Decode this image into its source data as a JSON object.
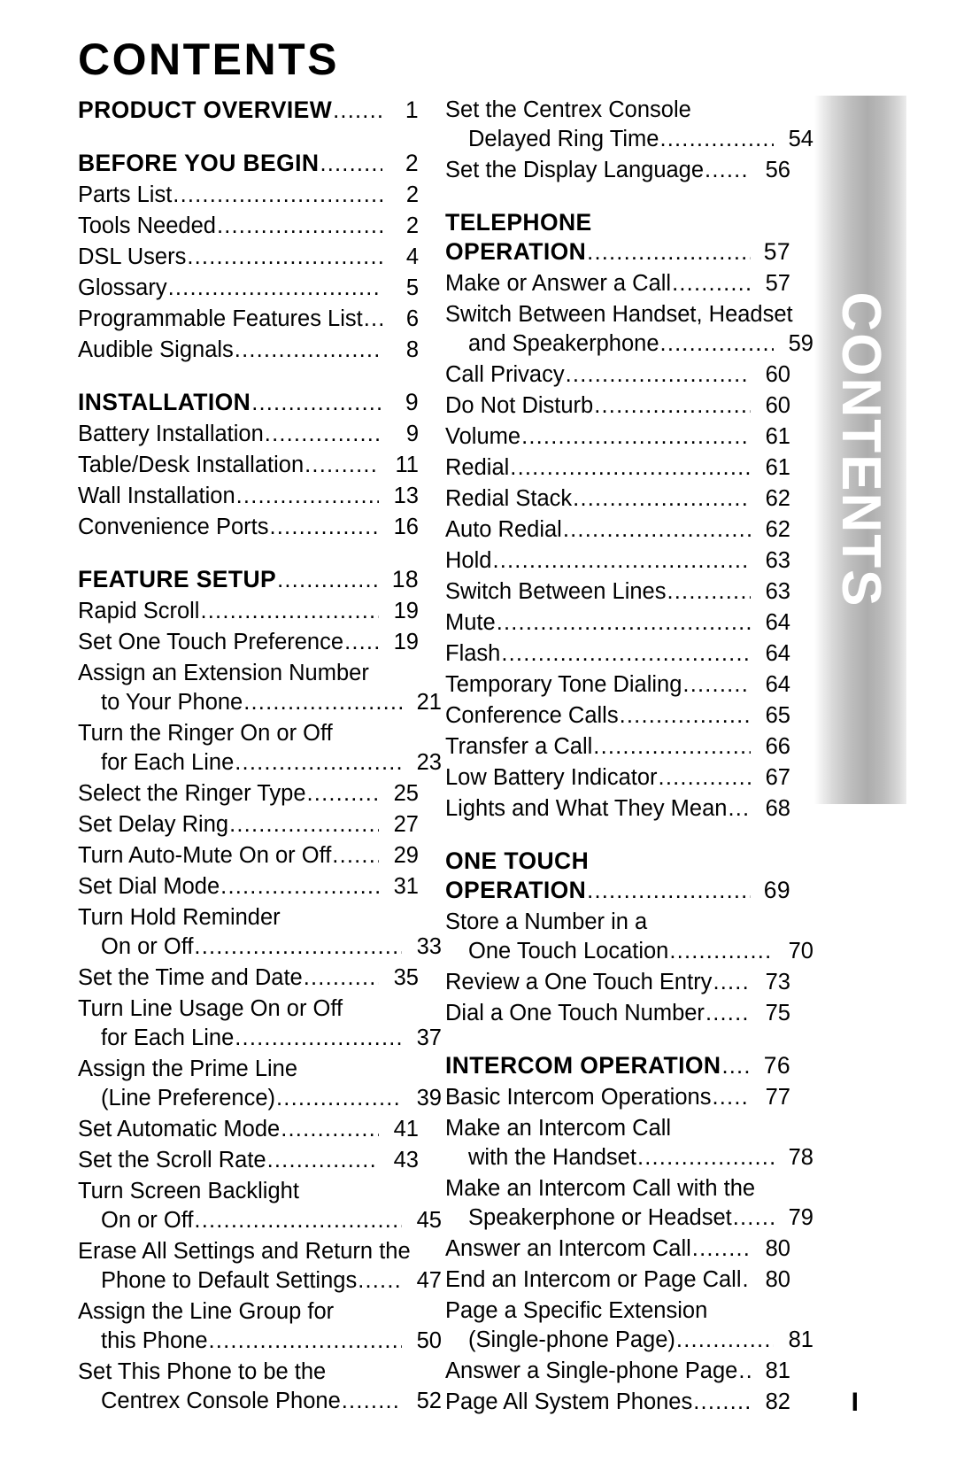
{
  "title": "CONTENTS",
  "side_tab": {
    "label": "CONTENTS"
  },
  "folio": "I",
  "columns": {
    "left": [
      {
        "kind": "head",
        "lines": [
          {
            "text": "PRODUCT OVERVIEW",
            "page": "1"
          }
        ]
      },
      {
        "kind": "head",
        "gap": true,
        "lines": [
          {
            "text": "BEFORE YOU BEGIN",
            "page": "2"
          }
        ]
      },
      {
        "kind": "sub",
        "lines": [
          {
            "text": "Parts List",
            "page": "2"
          }
        ]
      },
      {
        "kind": "sub",
        "lines": [
          {
            "text": "Tools Needed",
            "page": "2"
          }
        ]
      },
      {
        "kind": "sub",
        "lines": [
          {
            "text": "DSL Users",
            "page": "4"
          }
        ]
      },
      {
        "kind": "sub",
        "lines": [
          {
            "text": "Glossary",
            "page": "5"
          }
        ]
      },
      {
        "kind": "sub",
        "lines": [
          {
            "text": "Programmable Features List",
            "page": "6"
          }
        ]
      },
      {
        "kind": "sub",
        "lines": [
          {
            "text": "Audible Signals",
            "page": "8"
          }
        ]
      },
      {
        "kind": "head",
        "gap": true,
        "lines": [
          {
            "text": "INSTALLATION",
            "page": "9"
          }
        ]
      },
      {
        "kind": "sub",
        "lines": [
          {
            "text": "Battery Installation",
            "page": "9"
          }
        ]
      },
      {
        "kind": "sub",
        "lines": [
          {
            "text": "Table/Desk Installation",
            "page": "11"
          }
        ]
      },
      {
        "kind": "sub",
        "lines": [
          {
            "text": "Wall Installation",
            "page": "13"
          }
        ]
      },
      {
        "kind": "sub",
        "lines": [
          {
            "text": "Convenience Ports",
            "page": "16"
          }
        ]
      },
      {
        "kind": "head",
        "gap": true,
        "lines": [
          {
            "text": "FEATURE SETUP",
            "page": "18"
          }
        ]
      },
      {
        "kind": "sub",
        "lines": [
          {
            "text": "Rapid Scroll",
            "page": "19"
          }
        ]
      },
      {
        "kind": "sub",
        "lines": [
          {
            "text": "Set One Touch Preference",
            "page": "19"
          }
        ]
      },
      {
        "kind": "sub",
        "lines": [
          {
            "text": "Assign an Extension Number",
            "page": ""
          },
          {
            "text": "to Your Phone",
            "page": "21",
            "cont": true
          }
        ]
      },
      {
        "kind": "sub",
        "lines": [
          {
            "text": "Turn the Ringer On or Off",
            "page": ""
          },
          {
            "text": "for Each Line",
            "page": "23",
            "cont": true
          }
        ]
      },
      {
        "kind": "sub",
        "lines": [
          {
            "text": "Select the Ringer Type",
            "page": "25"
          }
        ]
      },
      {
        "kind": "sub",
        "lines": [
          {
            "text": "Set Delay Ring",
            "page": "27"
          }
        ]
      },
      {
        "kind": "sub",
        "lines": [
          {
            "text": "Turn Auto-Mute On or Off",
            "page": "29"
          }
        ]
      },
      {
        "kind": "sub",
        "lines": [
          {
            "text": "Set Dial Mode",
            "page": "31"
          }
        ]
      },
      {
        "kind": "sub",
        "lines": [
          {
            "text": "Turn Hold Reminder",
            "page": ""
          },
          {
            "text": "On or Off",
            "page": "33",
            "cont": true
          }
        ]
      },
      {
        "kind": "sub",
        "lines": [
          {
            "text": "Set the Time and Date",
            "page": "35"
          }
        ]
      },
      {
        "kind": "sub",
        "lines": [
          {
            "text": "Turn Line Usage On or Off",
            "page": ""
          },
          {
            "text": "for Each Line",
            "page": "37",
            "cont": true
          }
        ]
      },
      {
        "kind": "sub",
        "lines": [
          {
            "text": "Assign the Prime Line",
            "page": ""
          },
          {
            "text": "(Line Preference)",
            "page": "39",
            "cont": true
          }
        ]
      },
      {
        "kind": "sub",
        "lines": [
          {
            "text": "Set Automatic Mode",
            "page": "41"
          }
        ]
      },
      {
        "kind": "sub",
        "lines": [
          {
            "text": "Set the Scroll Rate",
            "page": "43"
          }
        ]
      },
      {
        "kind": "sub",
        "lines": [
          {
            "text": "Turn Screen Backlight",
            "page": ""
          },
          {
            "text": "On or Off",
            "page": "45",
            "cont": true
          }
        ]
      },
      {
        "kind": "sub",
        "lines": [
          {
            "text": "Erase All Settings and Return the",
            "page": ""
          },
          {
            "text": "Phone to Default Settings",
            "page": "47",
            "cont": true
          }
        ]
      },
      {
        "kind": "sub",
        "lines": [
          {
            "text": "Assign the Line Group for",
            "page": ""
          },
          {
            "text": "this Phone",
            "page": "50",
            "cont": true
          }
        ]
      },
      {
        "kind": "sub",
        "lines": [
          {
            "text": "Set This Phone to be the",
            "page": ""
          },
          {
            "text": "Centrex Console Phone",
            "page": "52",
            "cont": true
          }
        ]
      }
    ],
    "right": [
      {
        "kind": "sub",
        "lines": [
          {
            "text": "Set the Centrex Console",
            "page": ""
          },
          {
            "text": "Delayed Ring Time",
            "page": "54",
            "cont": true
          }
        ]
      },
      {
        "kind": "sub",
        "lines": [
          {
            "text": "Set the Display Language",
            "page": "56"
          }
        ]
      },
      {
        "kind": "head",
        "gap": true,
        "lines": [
          {
            "text": "TELEPHONE",
            "page": ""
          },
          {
            "text": "OPERATION",
            "page": "57"
          }
        ]
      },
      {
        "kind": "sub",
        "lines": [
          {
            "text": "Make or Answer a Call",
            "page": "57"
          }
        ]
      },
      {
        "kind": "sub",
        "lines": [
          {
            "text": "Switch Between Handset, Headset",
            "page": ""
          },
          {
            "text": "and Speakerphone",
            "page": "59",
            "cont": true
          }
        ]
      },
      {
        "kind": "sub",
        "lines": [
          {
            "text": "Call Privacy",
            "page": "60"
          }
        ]
      },
      {
        "kind": "sub",
        "lines": [
          {
            "text": "Do Not Disturb",
            "page": "60"
          }
        ]
      },
      {
        "kind": "sub",
        "lines": [
          {
            "text": "Volume",
            "page": "61"
          }
        ]
      },
      {
        "kind": "sub",
        "lines": [
          {
            "text": "Redial",
            "page": "61"
          }
        ]
      },
      {
        "kind": "sub",
        "lines": [
          {
            "text": "Redial Stack",
            "page": "62"
          }
        ]
      },
      {
        "kind": "sub",
        "lines": [
          {
            "text": "Auto Redial",
            "page": "62"
          }
        ]
      },
      {
        "kind": "sub",
        "lines": [
          {
            "text": "Hold",
            "page": "63"
          }
        ]
      },
      {
        "kind": "sub",
        "lines": [
          {
            "text": "Switch Between Lines",
            "page": "63"
          }
        ]
      },
      {
        "kind": "sub",
        "lines": [
          {
            "text": "Mute",
            "page": "64"
          }
        ]
      },
      {
        "kind": "sub",
        "lines": [
          {
            "text": "Flash",
            "page": "64"
          }
        ]
      },
      {
        "kind": "sub",
        "lines": [
          {
            "text": "Temporary Tone Dialing",
            "page": "64"
          }
        ]
      },
      {
        "kind": "sub",
        "lines": [
          {
            "text": "Conference Calls",
            "page": "65"
          }
        ]
      },
      {
        "kind": "sub",
        "lines": [
          {
            "text": "Transfer a Call",
            "page": "66"
          }
        ]
      },
      {
        "kind": "sub",
        "lines": [
          {
            "text": "Low Battery Indicator",
            "page": "67"
          }
        ]
      },
      {
        "kind": "sub",
        "lines": [
          {
            "text": "Lights and What They Mean",
            "page": "68"
          }
        ]
      },
      {
        "kind": "head",
        "gap": true,
        "lines": [
          {
            "text": "ONE TOUCH",
            "page": ""
          },
          {
            "text": "OPERATION",
            "page": "69"
          }
        ]
      },
      {
        "kind": "sub",
        "lines": [
          {
            "text": "Store a Number in a",
            "page": ""
          },
          {
            "text": "One Touch Location",
            "page": "70",
            "cont": true
          }
        ]
      },
      {
        "kind": "sub",
        "lines": [
          {
            "text": "Review a One Touch Entry",
            "page": "73"
          }
        ]
      },
      {
        "kind": "sub",
        "lines": [
          {
            "text": "Dial a One Touch Number",
            "page": "75"
          }
        ]
      },
      {
        "kind": "head",
        "gap": true,
        "lines": [
          {
            "text": "INTERCOM OPERATION",
            "page": "76"
          }
        ]
      },
      {
        "kind": "sub",
        "lines": [
          {
            "text": "Basic Intercom Operations",
            "page": "77"
          }
        ]
      },
      {
        "kind": "sub",
        "lines": [
          {
            "text": "Make an Intercom Call",
            "page": ""
          },
          {
            "text": "with the Handset",
            "page": "78",
            "cont": true
          }
        ]
      },
      {
        "kind": "sub",
        "lines": [
          {
            "text": "Make an Intercom Call with the",
            "page": ""
          },
          {
            "text": "Speakerphone or Headset",
            "page": "79",
            "cont": true
          }
        ]
      },
      {
        "kind": "sub",
        "lines": [
          {
            "text": "Answer an Intercom Call",
            "page": "80"
          }
        ]
      },
      {
        "kind": "sub",
        "lines": [
          {
            "text": "End an Intercom or Page Call",
            "page": "80"
          }
        ]
      },
      {
        "kind": "sub",
        "lines": [
          {
            "text": "Page a Specific Extension",
            "page": ""
          },
          {
            "text": "(Single-phone Page)",
            "page": "81",
            "cont": true
          }
        ]
      },
      {
        "kind": "sub",
        "lines": [
          {
            "text": "Answer a Single-phone Page",
            "page": "81"
          }
        ]
      },
      {
        "kind": "sub",
        "lines": [
          {
            "text": "Page All System Phones",
            "page": "82"
          }
        ]
      }
    ]
  }
}
